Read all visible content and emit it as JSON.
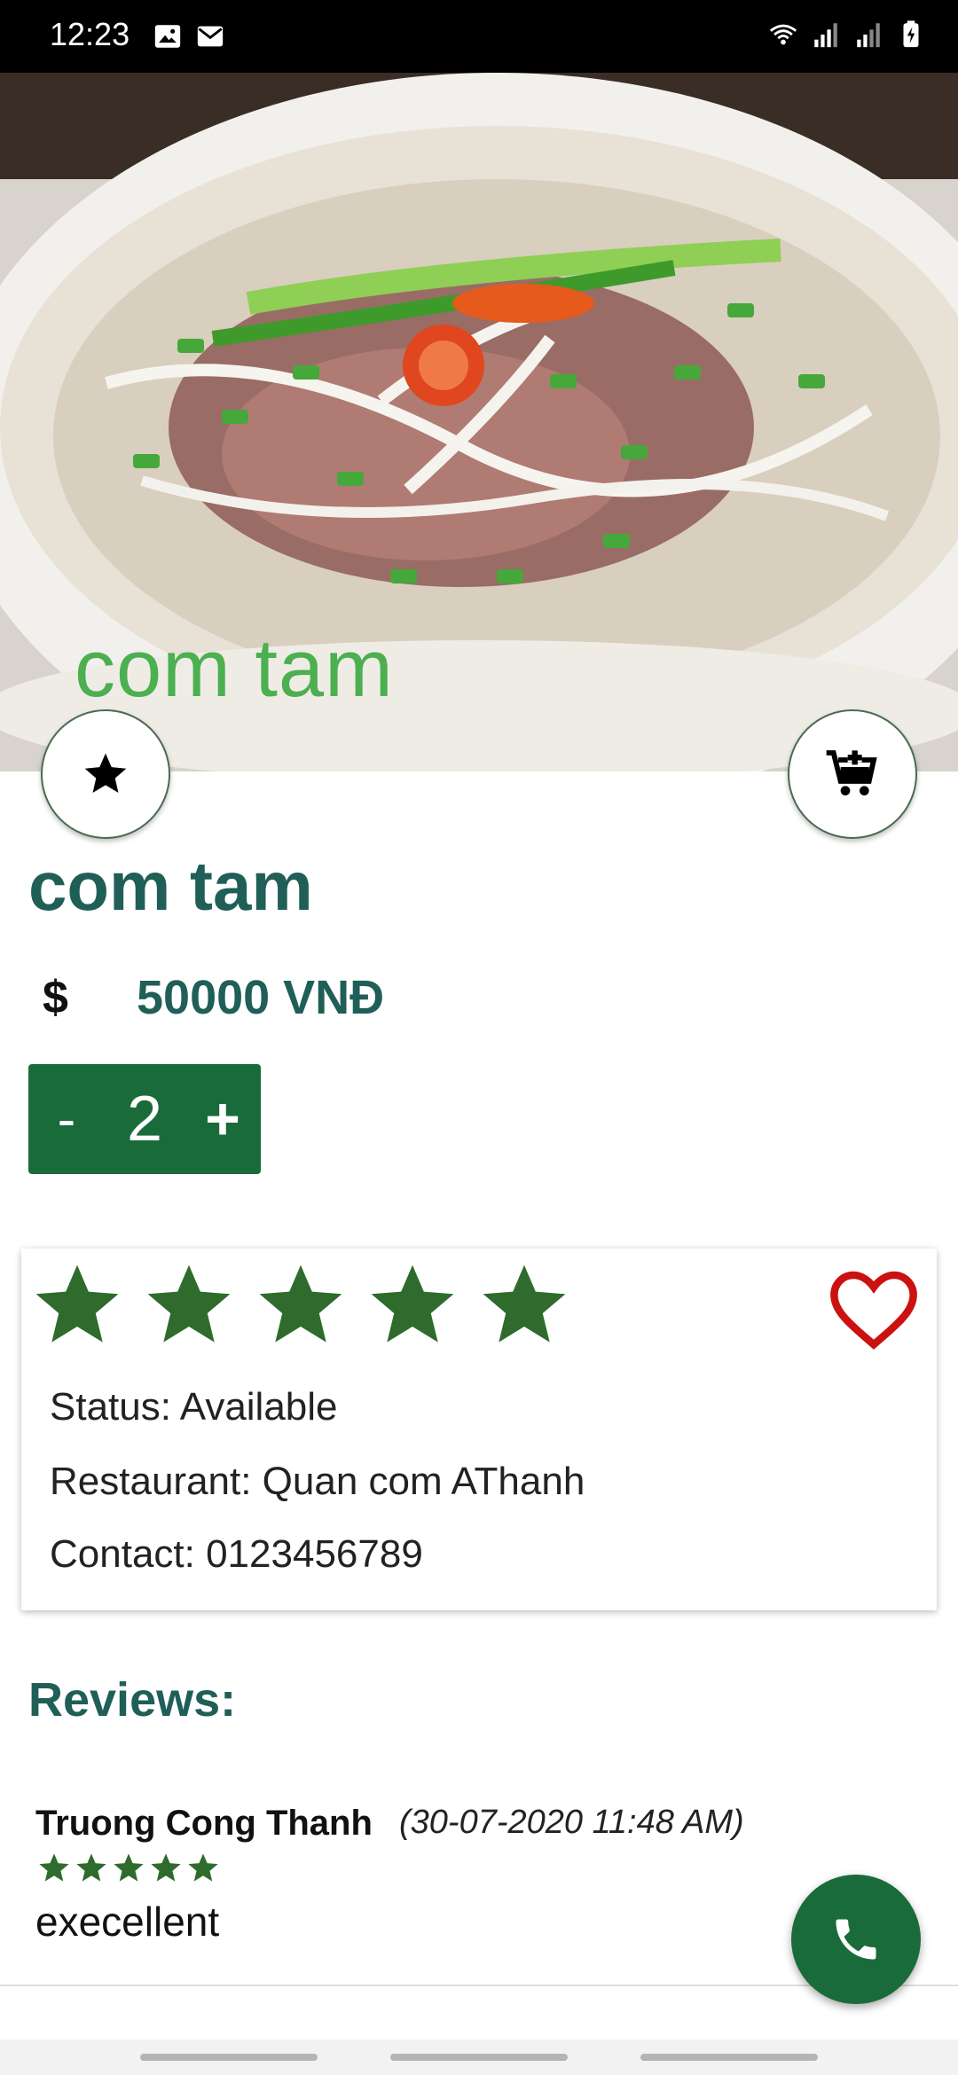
{
  "status_bar": {
    "time": "12:23",
    "left_icons": [
      "image-icon",
      "mail-icon"
    ],
    "right_icons": [
      "wifi-icon",
      "signal-icon",
      "signal-icon",
      "battery-charging-icon"
    ]
  },
  "hero": {
    "overlay_title": "com tam"
  },
  "actions": {
    "favorite_icon": "star-icon",
    "cart_icon": "add-to-cart-icon"
  },
  "product": {
    "name": "com tam",
    "currency_icon": "$",
    "price": "50000 VNĐ"
  },
  "quantity": {
    "minus_label": "-",
    "value": "2",
    "plus_label": "+"
  },
  "info_card": {
    "rating": 5,
    "rating_max": 5,
    "favorite_icon": "heart-outline-icon",
    "status": "Status: Available",
    "restaurant": "Restaurant: Quan com AThanh",
    "contact": "Contact: 0123456789"
  },
  "reviews": {
    "heading": "Reviews:",
    "items": [
      {
        "name": "Truong Cong Thanh",
        "date": "(30-07-2020  11:48 AM)",
        "rating": 5,
        "text": "execellent"
      }
    ]
  },
  "call_button": {
    "icon": "phone-icon"
  },
  "colors": {
    "primary_green": "#1a6b3a",
    "title_teal": "#1f5f58",
    "hero_title_green": "#4caf50",
    "heart_red": "#cc1111",
    "star_green": "#2e6b2c"
  }
}
